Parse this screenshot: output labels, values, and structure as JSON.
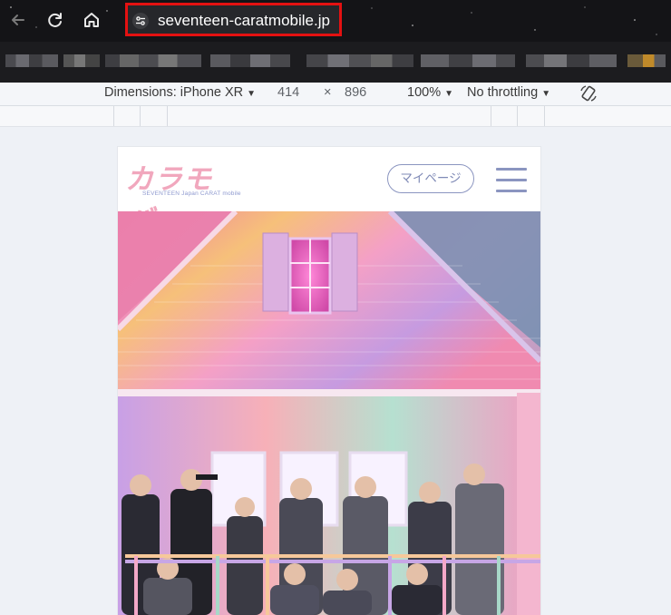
{
  "browser": {
    "url": "seventeen-caratmobile.jp",
    "back_icon": "arrow-back-icon",
    "reload_icon": "reload-icon",
    "home_icon": "home-icon",
    "site_info_icon": "tune-icon"
  },
  "devtools": {
    "dimensions_label": "Dimensions: iPhone XR",
    "width": "414",
    "times": "×",
    "height": "896",
    "zoom": "100%",
    "throttling": "No throttling",
    "dropdown_glyph": "▼",
    "rotate_icon": "rotate-icon"
  },
  "site": {
    "logo_text": "カラモバ",
    "logo_subtitle": "SEVENTEEN Japan CARAT mobile",
    "mypage_label": "マイページ",
    "menu_icon": "hamburger-icon"
  },
  "colors": {
    "highlight_border": "#e41111",
    "accent_blue": "#8b95c0",
    "logo_pink": "#f1a7bd"
  }
}
